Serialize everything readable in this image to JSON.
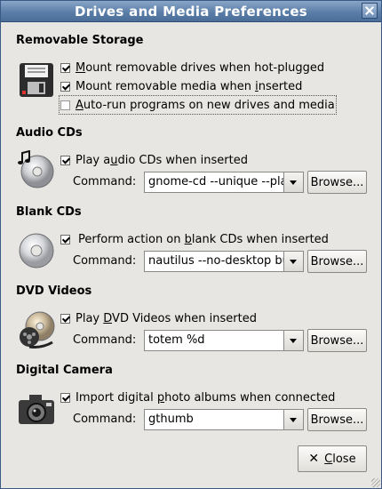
{
  "window": {
    "title": "Drives and Media Preferences"
  },
  "sections": {
    "removable": {
      "title": "Removable Storage",
      "options": [
        {
          "pre": "",
          "mn": "M",
          "post": "ount removable drives when hot-plugged",
          "checked": true
        },
        {
          "pre": "Mount removable media when ",
          "mn": "i",
          "post": "nserted",
          "checked": true
        },
        {
          "pre": "",
          "mn": "A",
          "post": "uto-run programs on new drives and media",
          "checked": false
        }
      ]
    },
    "audio": {
      "title": "Audio CDs",
      "option": {
        "pre": "Play a",
        "mn": "u",
        "post": "dio CDs when inserted",
        "checked": true
      },
      "command_label": "Command:",
      "command": "gnome-cd --unique --pla",
      "browse": "Browse..."
    },
    "blank": {
      "title": "Blank CDs",
      "option": {
        "pre": "Perform action on ",
        "mn": "b",
        "post": "lank CDs when inserted",
        "checked": true
      },
      "command_label": "Command:",
      "command": "nautilus --no-desktop bu",
      "browse": "Browse..."
    },
    "dvd": {
      "title": "DVD Videos",
      "option": {
        "pre": "Play ",
        "mn": "D",
        "post": "VD Videos when inserted",
        "checked": true
      },
      "command_label": "Command:",
      "command": "totem %d",
      "browse": "Browse..."
    },
    "camera": {
      "title": "Digital Camera",
      "option": {
        "pre": "Import digital ",
        "mn": "p",
        "post": "hoto albums when connected",
        "checked": true
      },
      "command_label": "Command:",
      "command": "gthumb",
      "browse": "Browse..."
    }
  },
  "footer": {
    "close_mn": "C",
    "close_rest": "lose"
  },
  "icons": {
    "window_close": "close-icon",
    "removable": "floppy-drive-icon",
    "audio": "audio-cd-icon",
    "blank": "blank-cd-icon",
    "dvd": "dvd-film-icon",
    "camera": "camera-icon",
    "close_button": "x-icon"
  }
}
